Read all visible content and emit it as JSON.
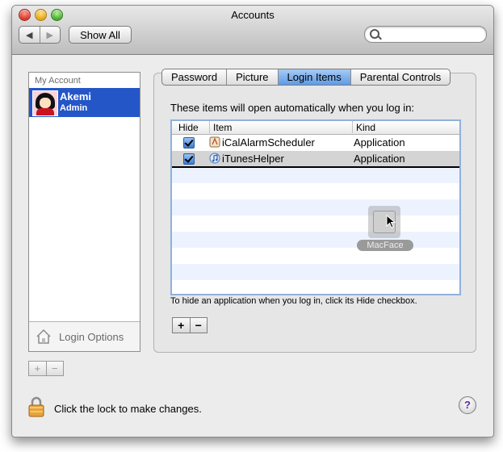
{
  "window": {
    "title": "Accounts"
  },
  "toolbar": {
    "back_glyph": "◀",
    "forward_glyph": "▶",
    "show_all_label": "Show All",
    "search_placeholder": ""
  },
  "accounts": {
    "section_label": "My Account",
    "items": [
      {
        "name": "Akemi",
        "role": "Admin",
        "selected": true
      }
    ],
    "login_options_label": "Login Options",
    "add_glyph": "+",
    "remove_glyph": "−"
  },
  "tabs": [
    {
      "label": "Password",
      "selected": false
    },
    {
      "label": "Picture",
      "selected": false
    },
    {
      "label": "Login Items",
      "selected": true
    },
    {
      "label": "Parental Controls",
      "selected": false
    }
  ],
  "login_items": {
    "intro": "These items will open automatically when you log in:",
    "columns": {
      "hide": "Hide",
      "item": "Item",
      "kind": "Kind"
    },
    "rows": [
      {
        "hide": true,
        "name": "iCalAlarmScheduler",
        "kind": "Application",
        "icon": "ical-alarm-icon"
      },
      {
        "hide": true,
        "name": "iTunesHelper",
        "kind": "Application",
        "icon": "itunes-helper-icon"
      }
    ],
    "hint": "To hide an application when you log in, click its Hide checkbox.",
    "add_glyph": "+",
    "remove_glyph": "−",
    "drag_item_label": "MacFace"
  },
  "footer": {
    "lock_text": "Click the lock to make changes.",
    "help_glyph": "?"
  },
  "colors": {
    "selection_blue": "#2456c8",
    "tab_selected": "#5e9ae4",
    "row_stripe": "#edf3fe"
  }
}
